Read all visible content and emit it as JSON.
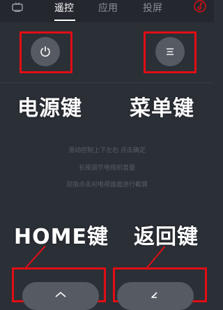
{
  "header": {
    "tabs": [
      {
        "label": "遥控",
        "active": true
      },
      {
        "label": "应用",
        "active": false
      },
      {
        "label": "投屏",
        "active": false
      }
    ],
    "left_icon": "tv-icon",
    "right_icon": "remote-icon"
  },
  "controls": {
    "power_icon": "power-icon",
    "menu_icon": "menu-icon",
    "home_icon": "home-icon",
    "back_icon": "back-icon"
  },
  "annotations": {
    "power": "电源键",
    "menu": "菜单键",
    "home": "HOME键",
    "back": "返回键"
  },
  "hints": [
    "滑动控制上下左右 点击确定",
    "长按调节电视机音量",
    "双指点击对电视画面进行截屏"
  ],
  "colors": {
    "background": "#2b2f36",
    "button": "#555a63",
    "highlight": "#e10e14",
    "active_tab": "#ffffff"
  }
}
